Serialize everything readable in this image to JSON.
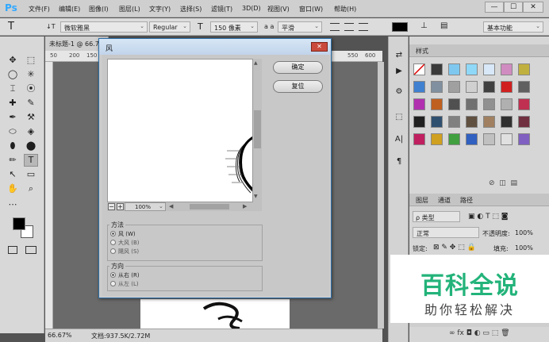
{
  "app": {
    "logo": "Ps"
  },
  "menu": [
    "文件(F)",
    "编辑(E)",
    "图像(I)",
    "图层(L)",
    "文字(Y)",
    "选择(S)",
    "滤镜(T)",
    "3D(D)",
    "视图(V)",
    "窗口(W)",
    "帮助(H)"
  ],
  "window_controls": {
    "minimize": "—",
    "maximize": "☐",
    "close": "✕"
  },
  "options": {
    "tool_glyph": "T",
    "orient_glyph": "↓T",
    "font_family": "微软雅黑",
    "font_style": "Regular",
    "size_glyph": "T",
    "font_size": "150 像素",
    "aa_glyph": "a a",
    "antialias": "平滑",
    "warp_glyph": "⊥",
    "panels_glyph": "▤",
    "workspace": "基本功能"
  },
  "document": {
    "tab_title": "未标题-1 @ 66.7",
    "zoom": "66.67%",
    "status": "文档:937.5K/2.72M",
    "ruler_top": [
      "50",
      "200",
      "150",
      "550",
      "600"
    ]
  },
  "tools": [
    "✥",
    "⬚",
    "◯",
    "✳",
    "⌶",
    "⦿",
    "✚",
    "✎",
    "✒",
    "⚒",
    "⬭",
    "◈",
    "⬮",
    "⬤",
    "✏",
    "T",
    "↖",
    "▭",
    "✋",
    "⌕",
    "⋯"
  ],
  "mid_panel_icons": [
    "⇄",
    "▶",
    "⚙",
    "⬚",
    "A|",
    "¶"
  ],
  "right": {
    "styles_tab": "样式",
    "layers_tabs": [
      "图层",
      "通道",
      "路径"
    ],
    "kind_filter": "ρ 类型",
    "blend_mode": "正常",
    "opacity_label": "不透明度:",
    "opacity_value": "100%",
    "lock_label": "锁定:",
    "fill_label": "填充:",
    "fill_value": "100%",
    "footer_icons": "∞ fx ◘ ◐ ▭ ⬚ 🗑",
    "swatch_colors": [
      "#ffffff",
      "#3a3a3a",
      "#7ec8f0",
      "#8fd8f8",
      "#d8e8f8",
      "#d08cc0",
      "#c0b040",
      "#4080d0",
      "#8090a0",
      "#a0a0a0",
      "#d0d0d0",
      "#404040",
      "#d02020",
      "#606060",
      "#b030b0",
      "#c06020",
      "#505050",
      "#707070",
      "#909090",
      "#b0b0b0",
      "#c03050",
      "#202020",
      "#305070",
      "#808080",
      "#605040",
      "#a08060",
      "#303030",
      "#703040",
      "#c02060",
      "#d0a020",
      "#40a040",
      "#3060c0",
      "#c0c0c0",
      "#e0e0e0",
      "#8060c0"
    ]
  },
  "watermark": {
    "main": "百科全说",
    "sub": "助你轻松解决"
  },
  "dialog": {
    "title": "风",
    "close": "✕",
    "ok": "确定",
    "reset": "复位",
    "zoom": "100%",
    "method_label": "方法",
    "methods": [
      "风 (W)",
      "大风 (B)",
      "飓风 (S)"
    ],
    "selected_method": "风 (W)",
    "direction_label": "方向",
    "directions": [
      "从右 (R)",
      "从左 (L)"
    ],
    "selected_direction": "从右 (R)"
  }
}
